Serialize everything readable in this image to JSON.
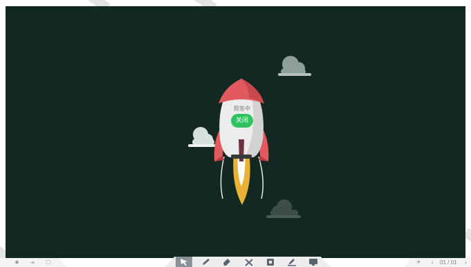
{
  "rocket": {
    "status_text": "照答中",
    "close_label": "关闭"
  },
  "bottom_left": {
    "icons": [
      "settings-icon",
      "exit-icon",
      "square-icon"
    ]
  },
  "toolbar": {
    "tools": [
      {
        "icon": "select-arrow-icon",
        "active": true
      },
      {
        "icon": "pen-icon",
        "active": false
      },
      {
        "icon": "eraser-icon",
        "active": false
      },
      {
        "icon": "tools-icon",
        "active": false
      },
      {
        "icon": "resource-icon",
        "active": false
      },
      {
        "icon": "annotate-icon",
        "active": false
      },
      {
        "icon": "screen-icon",
        "active": false
      }
    ]
  },
  "bottom_right": {
    "add_label": "+",
    "prev_label": "‹",
    "page_indicator": "01 / 01",
    "next_label": "›"
  },
  "colors": {
    "board": "#142822",
    "close_button": "#31c260",
    "rocket_red": "#e05a5e",
    "flame": "#e8b236",
    "active_tool": "#8a9199"
  }
}
